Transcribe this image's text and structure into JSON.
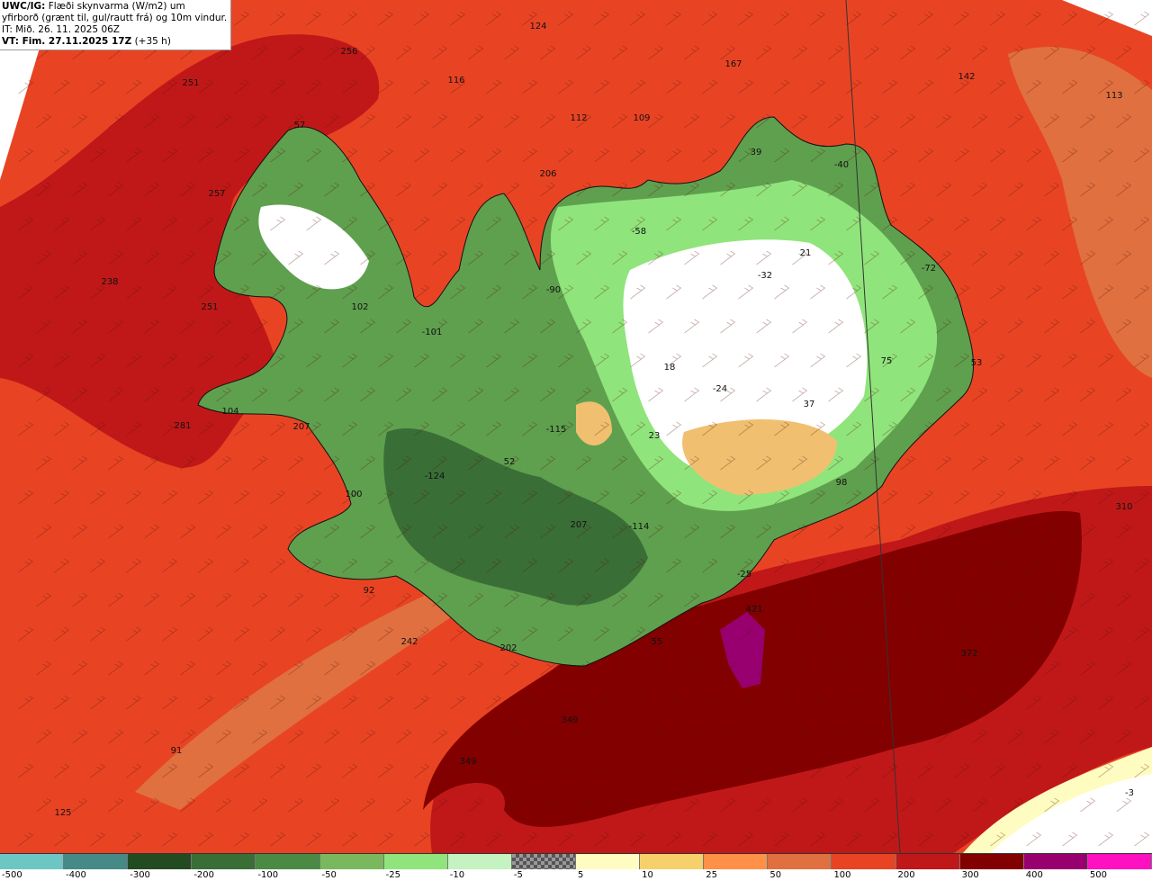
{
  "header": {
    "line1_bold": "UWC/IG:",
    "line1": " Flæði skynvarma (W/m2) um",
    "line2": "yfirborð (grænt til, gul/rautt frá) og 10m vindur.",
    "line3": "IT: Mið. 26. 11. 2025 06Z",
    "line4_bold": "VT: Fim. 27.11.2025 17Z",
    "line4": " (+35 h)"
  },
  "colors": {
    "ocean": "#e84424",
    "ocean_dark": "#c01818",
    "ocean_darkest": "#820000",
    "purple": "#980070",
    "land": "#5fa04f",
    "land_dark": "#3a6e37",
    "land_light": "#90e47c",
    "snow": "#ffffff",
    "tan": "#f0c070"
  },
  "legend": {
    "bins": [
      {
        "color": "#6cc6c4",
        "label": "-500"
      },
      {
        "color": "#458a87",
        "label": "-400"
      },
      {
        "color": "#234b22",
        "label": "-300"
      },
      {
        "color": "#3a6e37",
        "label": "-200"
      },
      {
        "color": "#4a8a44",
        "label": "-100"
      },
      {
        "color": "#7ab85e",
        "label": "-50"
      },
      {
        "color": "#90e47c",
        "label": "-25"
      },
      {
        "color": "#c4f2c0",
        "label": "-10"
      },
      {
        "color": "checker",
        "label": "-5"
      },
      {
        "color": "#fefcc0",
        "label": "5"
      },
      {
        "color": "#f6d06a",
        "label": "10"
      },
      {
        "color": "#fe9048",
        "label": "25"
      },
      {
        "color": "#e07040",
        "label": "50"
      },
      {
        "color": "#e84424",
        "label": "100"
      },
      {
        "color": "#c01818",
        "label": "200"
      },
      {
        "color": "#820000",
        "label": "300"
      },
      {
        "color": "#980070",
        "label": "400"
      },
      {
        "color": "#ff10c0",
        "label": "500"
      }
    ]
  },
  "map_values": [
    "124",
    "256",
    "167",
    "142",
    "251",
    "116",
    "113",
    "112",
    "109",
    "57",
    "39",
    "-40",
    "206",
    "257",
    "-58",
    "21",
    "-72",
    "-32",
    "238",
    "-90",
    "251",
    "102",
    "-101",
    "75",
    "53",
    "18",
    "-24",
    "37",
    "281",
    "104",
    "207",
    "-115",
    "23",
    "52",
    "-124",
    "98",
    "100",
    "310",
    "207",
    "-114",
    "-25",
    "92",
    "421",
    "242",
    "202",
    "55",
    "372",
    "349",
    "91",
    "349",
    "-3",
    "125"
  ]
}
